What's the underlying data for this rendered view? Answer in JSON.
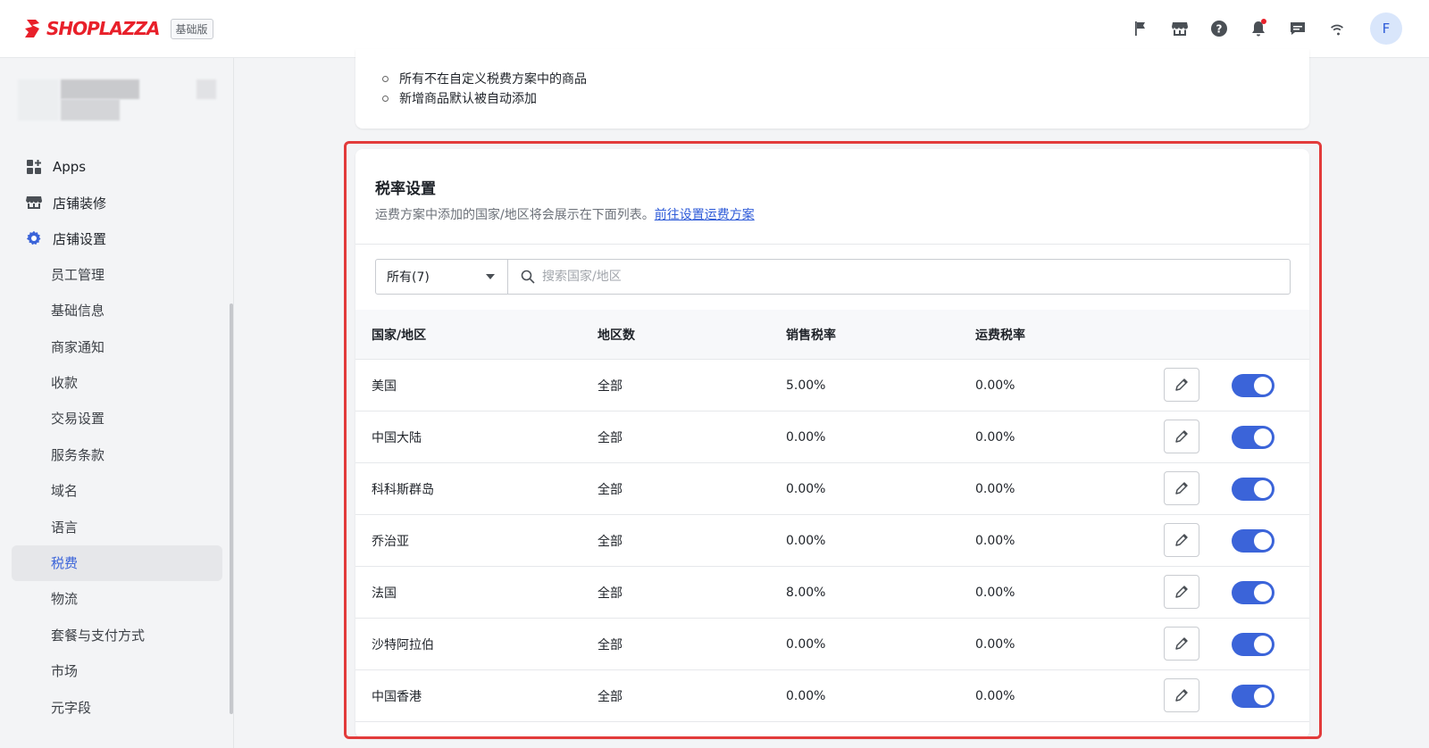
{
  "header": {
    "logo_text": "SHOPLAZZA",
    "plan_badge": "基础版",
    "avatar_initial": "F",
    "icons": [
      "flag-icon",
      "store-icon",
      "help-icon",
      "bell-icon",
      "chat-icon",
      "wifi-icon"
    ]
  },
  "sidebar": {
    "items": [
      {
        "label": "Apps",
        "icon": "apps-icon"
      },
      {
        "label": "店铺装修",
        "icon": "store-icon"
      },
      {
        "label": "店铺设置",
        "icon": "gear-icon"
      }
    ],
    "sub_items": [
      "员工管理",
      "基础信息",
      "商家通知",
      "收款",
      "交易设置",
      "服务条款",
      "域名",
      "语言",
      "税费",
      "物流",
      "套餐与支付方式",
      "市场",
      "元字段"
    ],
    "active_sub": "税费"
  },
  "top_card": {
    "bullets": [
      "所有不在自定义税费方案中的商品",
      "新增商品默认被自动添加"
    ]
  },
  "tax_card": {
    "title": "税率设置",
    "description": "运费方案中添加的国家/地区将会展示在下面列表。",
    "link_text": "前往设置运费方案",
    "filter_value": "所有(7)",
    "search_placeholder": "搜索国家/地区",
    "columns": [
      "国家/地区",
      "地区数",
      "销售税率",
      "运费税率"
    ],
    "rows": [
      {
        "country": "美国",
        "regions": "全部",
        "sales_tax": "5.00%",
        "shipping_tax": "0.00%",
        "enabled": true
      },
      {
        "country": "中国大陆",
        "regions": "全部",
        "sales_tax": "0.00%",
        "shipping_tax": "0.00%",
        "enabled": true
      },
      {
        "country": "科科斯群岛",
        "regions": "全部",
        "sales_tax": "0.00%",
        "shipping_tax": "0.00%",
        "enabled": true
      },
      {
        "country": "乔治亚",
        "regions": "全部",
        "sales_tax": "0.00%",
        "shipping_tax": "0.00%",
        "enabled": true
      },
      {
        "country": "法国",
        "regions": "全部",
        "sales_tax": "8.00%",
        "shipping_tax": "0.00%",
        "enabled": true
      },
      {
        "country": "沙特阿拉伯",
        "regions": "全部",
        "sales_tax": "0.00%",
        "shipping_tax": "0.00%",
        "enabled": true
      },
      {
        "country": "中国香港",
        "regions": "全部",
        "sales_tax": "0.00%",
        "shipping_tax": "0.00%",
        "enabled": true
      }
    ]
  },
  "colors": {
    "brand": "#e8202a",
    "accent": "#3b64d9",
    "highlight": "#e23b3b"
  }
}
